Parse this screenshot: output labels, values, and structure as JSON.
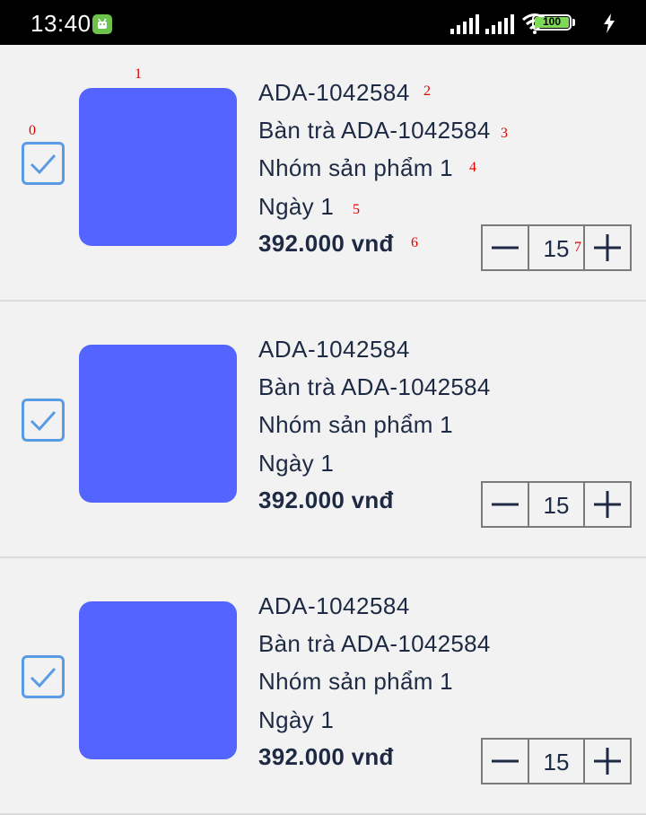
{
  "status_bar": {
    "time": "13:40",
    "battery": "100"
  },
  "annotations": [
    "0",
    "1",
    "2",
    "3",
    "4",
    "5",
    "6",
    "7"
  ],
  "items": [
    {
      "checked": true,
      "code": "ADA-1042584",
      "name": "Bàn trà ADA-1042584",
      "group": "Nhóm sản phẩm 1",
      "day": "Ngày  1",
      "price": "392.000 vnđ",
      "quantity": "15"
    },
    {
      "checked": true,
      "code": "ADA-1042584",
      "name": "Bàn trà ADA-1042584",
      "group": "Nhóm sản phẩm 1",
      "day": "Ngày 1",
      "price": "392.000 vnđ",
      "quantity": "15"
    },
    {
      "checked": true,
      "code": "ADA-1042584",
      "name": "Bàn trà ADA-1042584",
      "group": "Nhóm sản phẩm 1",
      "day": "Ngày 1",
      "price": "392.000 vnđ",
      "quantity": "15"
    }
  ],
  "colors": {
    "thumbnail": "#5465ff",
    "checkbox": "#5b9be6",
    "text": "#1e2a44",
    "annotation": "#e00000"
  },
  "icons": {
    "checkbox": "check-icon",
    "minus": "minus-icon",
    "plus": "plus-icon"
  }
}
